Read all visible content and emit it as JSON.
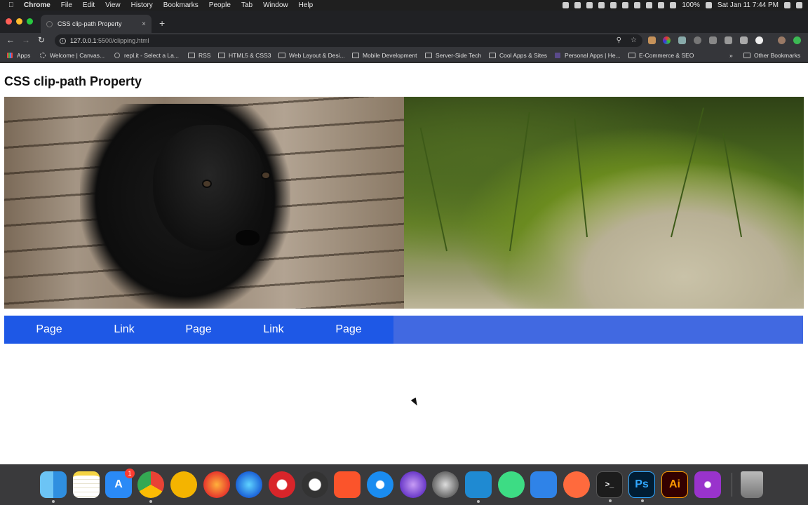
{
  "menubar": {
    "items": [
      "Chrome",
      "File",
      "Edit",
      "View",
      "History",
      "Bookmarks",
      "People",
      "Tab",
      "Window",
      "Help"
    ],
    "battery": "100%",
    "datetime": "Sat Jan 11  7:44 PM"
  },
  "tab": {
    "title": "CSS clip-path Property",
    "close": "×"
  },
  "toolbar": {
    "back": "←",
    "forward": "→",
    "reload": "↻",
    "url_host": "127.0.0.1",
    "url_path": ":5500/clipping.html"
  },
  "bookmarks": {
    "items": [
      {
        "label": "Apps",
        "icon": "apps-icon"
      },
      {
        "label": "Welcome | Canvas...",
        "icon": "canvas-icon"
      },
      {
        "label": "repl.it - Select a La...",
        "icon": "replit-icon"
      },
      {
        "label": "RSS",
        "icon": "folder-icon"
      },
      {
        "label": "HTML5 & CSS3",
        "icon": "folder-icon"
      },
      {
        "label": "Web Layout & Desi...",
        "icon": "folder-icon"
      },
      {
        "label": "Mobile Development",
        "icon": "folder-icon"
      },
      {
        "label": "Server-Side Tech",
        "icon": "folder-icon"
      },
      {
        "label": "Cool Apps & Sites",
        "icon": "folder-icon"
      },
      {
        "label": "Personal Apps | He...",
        "icon": "h-icon"
      },
      {
        "label": "E-Commerce & SEO",
        "icon": "folder-icon"
      }
    ],
    "more": "»",
    "other": "Other Bookmarks"
  },
  "page": {
    "title": "CSS clip-path Property",
    "nav_links": [
      "Page",
      "Link",
      "Page",
      "Link",
      "Page"
    ]
  },
  "colors": {
    "nav_bar": "#4169e1",
    "nav_clip": "#1e58e6"
  },
  "dock": {
    "apps": [
      "finder-icon",
      "notes-icon",
      "app-store-icon",
      "chrome-icon",
      "chrome-canary-icon",
      "firefox-icon",
      "firefox-dev-icon",
      "opera-icon",
      "tor-icon",
      "brave-icon",
      "safari-icon",
      "safari-preview-icon",
      "motion-icon",
      "vscode-icon",
      "android-studio-icon",
      "xcode-icon",
      "sketchbook-icon",
      "terminal-icon",
      "photoshop-icon",
      "illustrator-icon",
      "podcasts-icon",
      "trash-icon"
    ],
    "app_store_badge": "1",
    "ps_label": "Ps",
    "ai_label": "Ai"
  }
}
